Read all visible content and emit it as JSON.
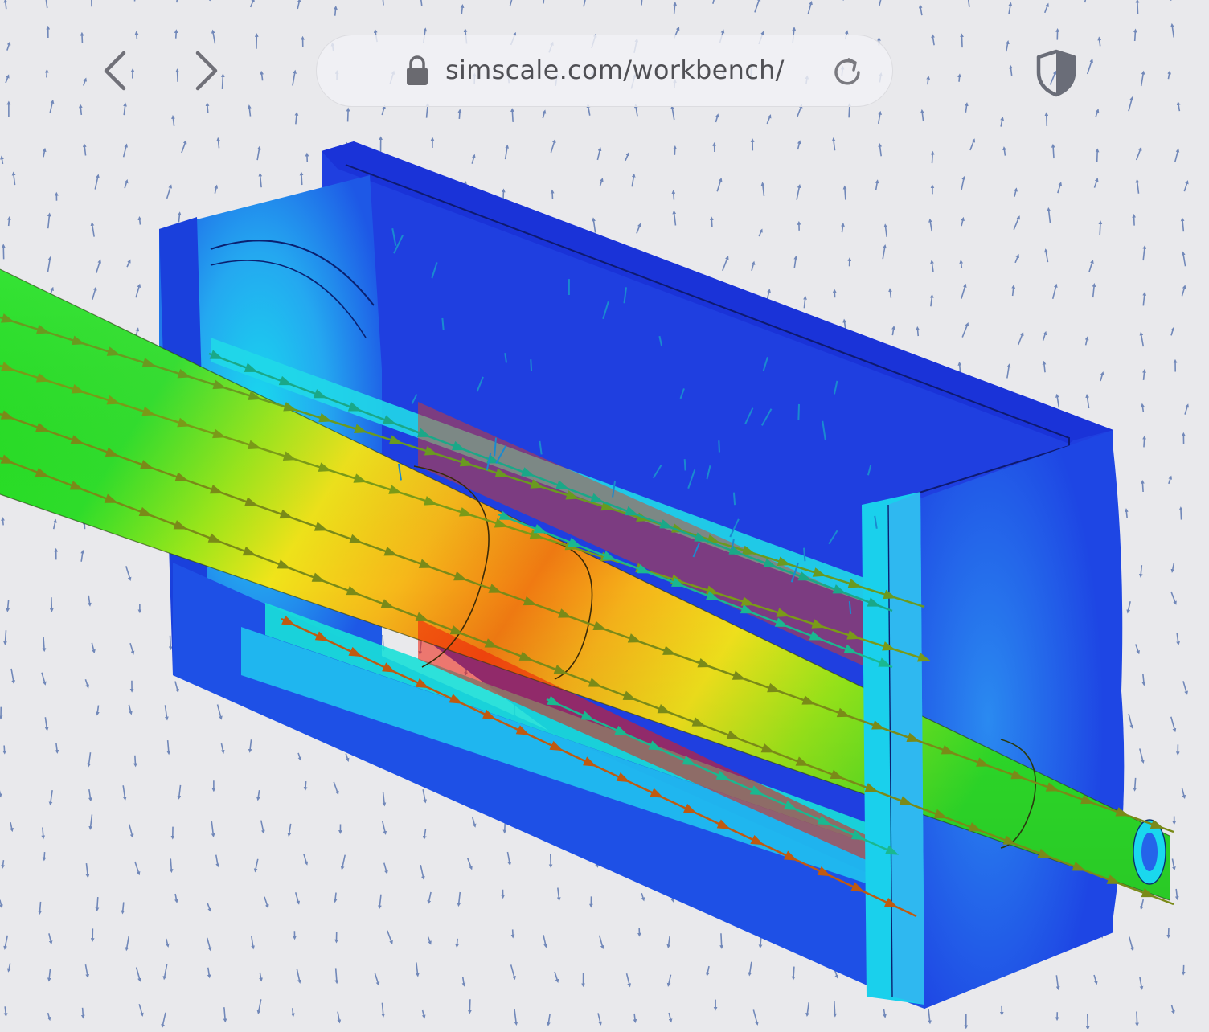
{
  "browser": {
    "url": "simscale.com/workbench/",
    "icons": {
      "back": "chevron-left-icon",
      "forward": "chevron-right-icon",
      "lock": "lock-icon",
      "reload": "reload-icon",
      "privacy": "shield-icon"
    }
  },
  "simulation": {
    "colors": {
      "low": "#1f3fe0",
      "low_mid": "#1ad6f0",
      "mid": "#2ee02a",
      "high_mid": "#f4e21a",
      "high": "#ee1a0a",
      "background": "#e9e9ec",
      "vector_arrow": "#3a5a9a"
    }
  }
}
